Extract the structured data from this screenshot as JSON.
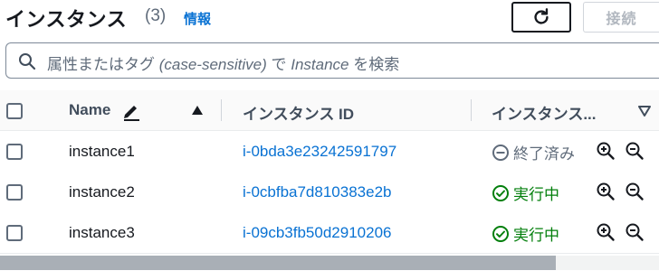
{
  "header": {
    "title": "インスタンス",
    "count": "(3)",
    "info_link": "情報",
    "connect_label": "接続"
  },
  "search": {
    "placeholder_prefix": "属性またはタグ ",
    "placeholder_case": "(case-sensitive)",
    "placeholder_mid": " で ",
    "placeholder_instance": "Instance",
    "placeholder_suffix": " を検索"
  },
  "table": {
    "columns": {
      "name": "Name",
      "instance_id": "インスタンス ID",
      "state": "インスタンス..."
    },
    "rows": [
      {
        "name": "instance1",
        "id": "i-0bda3e23242591797",
        "state": "終了済み",
        "status": "stopped"
      },
      {
        "name": "instance2",
        "id": "i-0cbfba7d810383e2b",
        "state": "実行中",
        "status": "running"
      },
      {
        "name": "instance3",
        "id": "i-09cb3fb50d2910206",
        "state": "実行中",
        "status": "running"
      }
    ]
  },
  "colors": {
    "link": "#0972d3",
    "running": "#037f0c",
    "stopped": "#5f6b7a"
  }
}
